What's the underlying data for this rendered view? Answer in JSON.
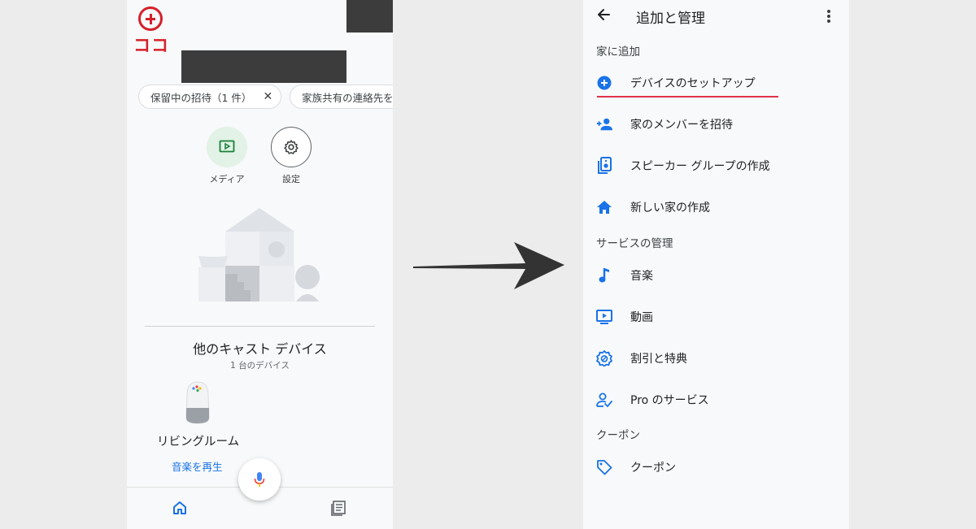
{
  "left": {
    "annotation": {
      "text": "ココ",
      "color": "#d6202a"
    },
    "chips": [
      {
        "label": "保留中の招待（1 件）",
        "close": "✕"
      },
      {
        "label": "家族共有の連絡先を"
      }
    ],
    "actions": [
      {
        "label": "メディア",
        "icon": "media-play-icon"
      },
      {
        "label": "設定",
        "icon": "gear-icon"
      }
    ],
    "other_devices": {
      "title": "他のキャスト デバイス",
      "subtitle": "1 台のデバイス"
    },
    "device": {
      "name": "リビングルーム",
      "action": "音楽を再生"
    },
    "bottom_nav": [
      "home-icon",
      "feed-icon"
    ]
  },
  "right": {
    "title": "追加と管理",
    "sections": {
      "add_home": "家に追加",
      "manage_services": "サービスの管理",
      "coupons": "クーポン"
    },
    "add_items": [
      {
        "label": "デバイスのセットアップ",
        "icon": "add-circle-icon"
      },
      {
        "label": "家のメンバーを招待",
        "icon": "person-add-icon"
      },
      {
        "label": "スピーカー グループの作成",
        "icon": "speaker-group-icon"
      },
      {
        "label": "新しい家の作成",
        "icon": "home-icon"
      }
    ],
    "service_items": [
      {
        "label": "音楽",
        "icon": "music-note-icon"
      },
      {
        "label": "動画",
        "icon": "video-icon"
      },
      {
        "label": "割引と特典",
        "icon": "offer-icon"
      },
      {
        "label": "Pro のサービス",
        "icon": "pro-service-icon"
      }
    ],
    "coupon_items": [
      {
        "label": "クーポン",
        "icon": "tag-icon"
      }
    ],
    "accent_color": "#1a73e8",
    "highlight_color": "#e0334a"
  }
}
